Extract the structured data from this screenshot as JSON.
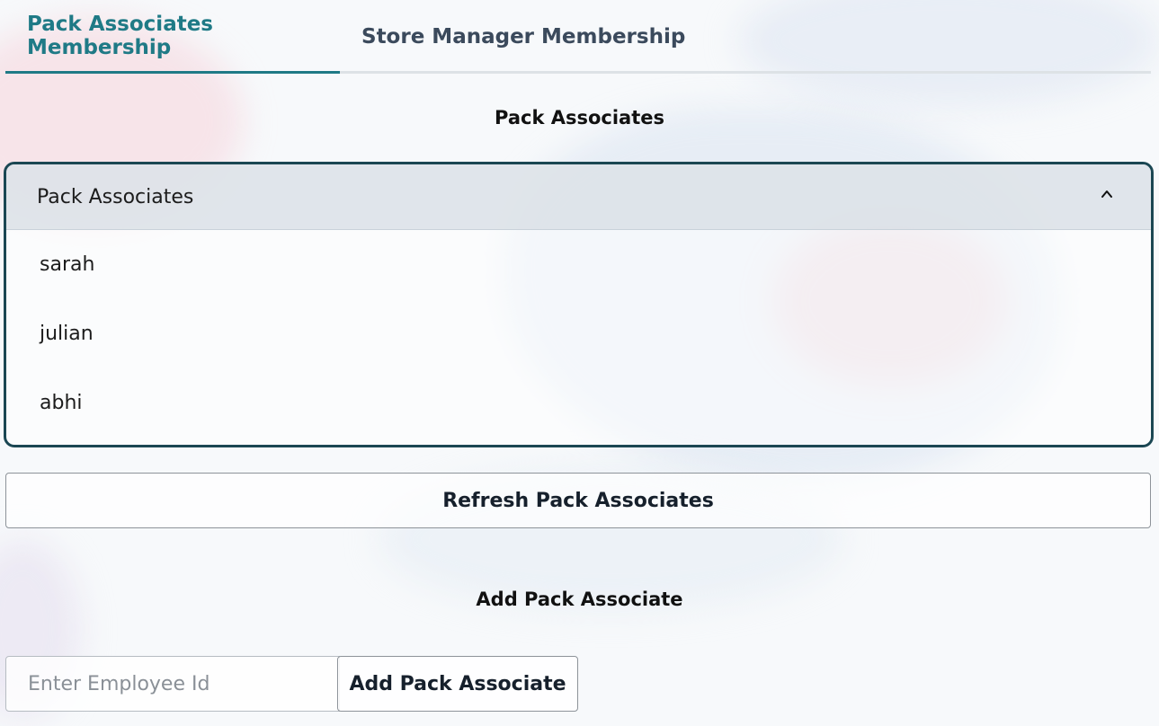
{
  "tabs": [
    {
      "label": "Pack Associates Membership",
      "active": true
    },
    {
      "label": "Store Manager Membership",
      "active": false
    }
  ],
  "pack_section": {
    "title": "Pack Associates",
    "dropdown": {
      "header": "Pack Associates",
      "expanded": true,
      "items": [
        "sarah",
        "julian",
        "abhi"
      ]
    },
    "refresh_label": "Refresh Pack Associates"
  },
  "add_section": {
    "title": "Add Pack Associate",
    "input_placeholder": "Enter Employee Id",
    "input_value": "",
    "button_label": "Add Pack Associate"
  },
  "colors": {
    "accent": "#1f7a86",
    "border_dark": "#1b4753",
    "tab_inactive": "#3b4a5c"
  },
  "icons": {
    "dropdown_toggle": "chevron-up-icon"
  }
}
